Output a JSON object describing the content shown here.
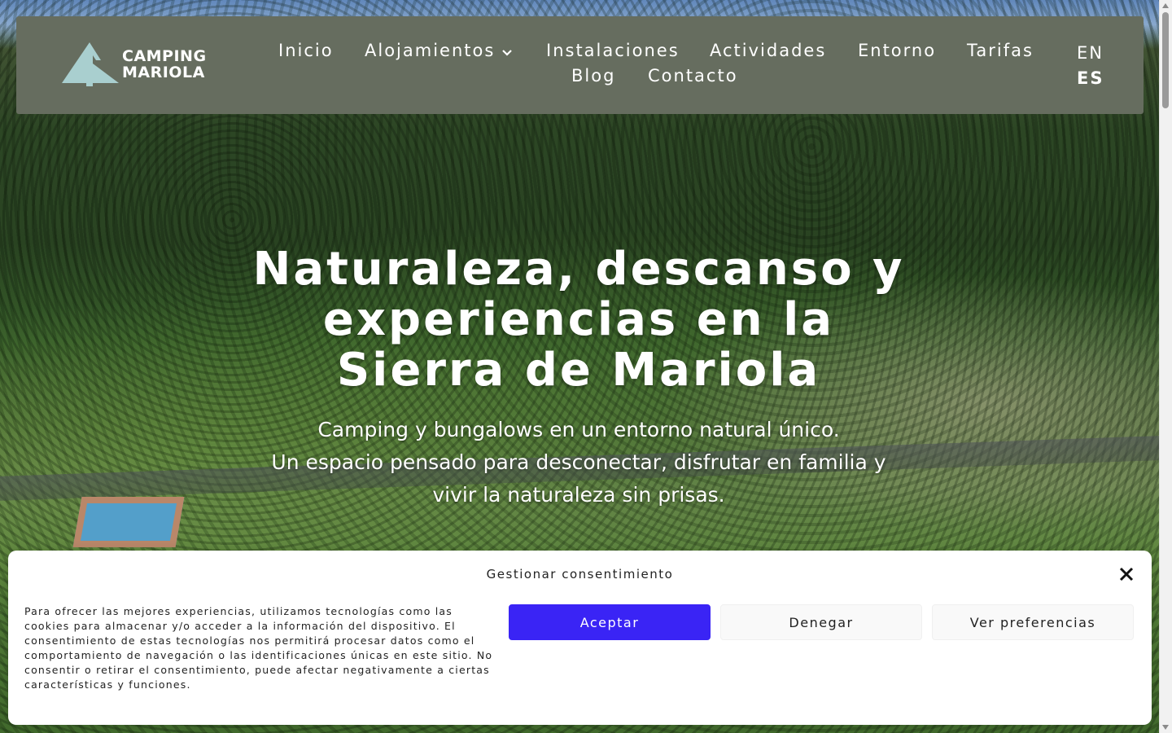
{
  "brand": {
    "logo_line1": "CAMPING",
    "logo_line2": "MARIOLA",
    "logo_icon": "tent-mountain-logo-icon",
    "header_color": "#666d5f",
    "logo_mark_color": "#a9cfcf"
  },
  "nav": {
    "items": [
      {
        "label": "Inicio"
      },
      {
        "label": "Alojamientos",
        "has_dropdown": true
      },
      {
        "label": "Instalaciones"
      },
      {
        "label": "Actividades"
      },
      {
        "label": "Entorno"
      },
      {
        "label": "Tarifas"
      },
      {
        "label": "Blog"
      },
      {
        "label": "Contacto"
      }
    ],
    "dropdown_icon": "chevron-down-icon"
  },
  "languages": {
    "options": [
      "EN",
      "ES"
    ],
    "active": "ES"
  },
  "hero": {
    "title_line1": "Naturaleza, descanso y",
    "title_line2": "experiencias en la",
    "title_line3": "Sierra de Mariola",
    "subtitle_line1": "Camping y bungalows en un entorno natural único.",
    "subtitle_line2": "Un espacio pensado para desconectar, disfrutar en familia y",
    "subtitle_line3": "vivir la naturaleza sin prisas."
  },
  "consent": {
    "title": "Gestionar consentimiento",
    "text": "Para ofrecer las mejores experiencias, utilizamos tecnologías como las cookies para almacenar y/o acceder a la información del dispositivo. El consentimiento de estas tecnologías nos permitirá procesar datos como el comportamiento de navegación o las identificaciones únicas en este sitio. No consentir o retirar el consentimiento, puede afectar negativamente a ciertas características y funciones.",
    "accept_label": "Aceptar",
    "deny_label": "Denegar",
    "preferences_label": "Ver preferencias",
    "close_icon": "close-icon",
    "accept_color": "#3a24f5"
  }
}
